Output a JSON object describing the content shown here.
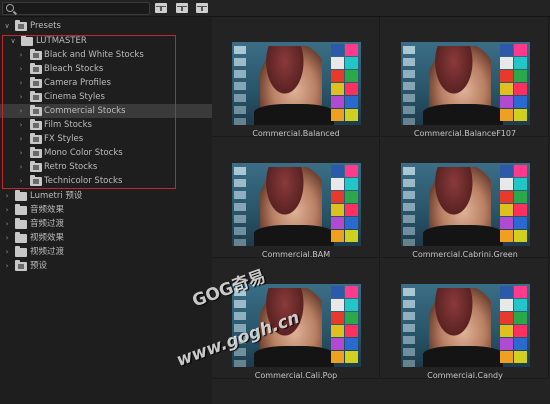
{
  "search": {
    "value": "",
    "placeholder": ""
  },
  "toolbar": {
    "buttons": [
      "new-bin-icon",
      "new-preset-icon",
      "new-item-icon"
    ]
  },
  "tree": [
    {
      "label": "Presets",
      "level": 0,
      "expanded": true,
      "icon": "preset-folder-icon"
    },
    {
      "label": "LUTMASTER",
      "level": 1,
      "expanded": true,
      "icon": "folder-icon"
    },
    {
      "label": "Black and White Stocks",
      "level": 2,
      "expanded": false,
      "icon": "preset-folder-icon"
    },
    {
      "label": "Bleach Stocks",
      "level": 2,
      "expanded": false,
      "icon": "preset-folder-icon"
    },
    {
      "label": "Camera Profiles",
      "level": 2,
      "expanded": false,
      "icon": "preset-folder-icon"
    },
    {
      "label": "Cinema Styles",
      "level": 2,
      "expanded": false,
      "icon": "preset-folder-icon"
    },
    {
      "label": "Commercial Stocks",
      "level": 2,
      "expanded": false,
      "icon": "preset-folder-icon",
      "selected": true
    },
    {
      "label": "Film Stocks",
      "level": 2,
      "expanded": false,
      "icon": "preset-folder-icon"
    },
    {
      "label": "FX Styles",
      "level": 2,
      "expanded": false,
      "icon": "preset-folder-icon"
    },
    {
      "label": "Mono Color Stocks",
      "level": 2,
      "expanded": false,
      "icon": "preset-folder-icon"
    },
    {
      "label": "Retro Stocks",
      "level": 2,
      "expanded": false,
      "icon": "preset-folder-icon"
    },
    {
      "label": "Technicolor Stocks",
      "level": 2,
      "expanded": false,
      "icon": "preset-folder-icon"
    },
    {
      "label": "Lumetri 预设",
      "level": 0,
      "expanded": false,
      "icon": "folder-icon"
    },
    {
      "label": "音频效果",
      "level": 0,
      "expanded": false,
      "icon": "folder-icon"
    },
    {
      "label": "音频过渡",
      "level": 0,
      "expanded": false,
      "icon": "folder-icon"
    },
    {
      "label": "视频效果",
      "level": 0,
      "expanded": false,
      "icon": "folder-icon"
    },
    {
      "label": "视频过渡",
      "level": 0,
      "expanded": false,
      "icon": "folder-icon"
    },
    {
      "label": "预设",
      "level": 0,
      "expanded": false,
      "icon": "preset-folder-icon"
    }
  ],
  "thumbnails": [
    {
      "name": "Commercial.Balanced"
    },
    {
      "name": "Commercial.BalanceF107"
    },
    {
      "name": "Commercial.BAM"
    },
    {
      "name": "Commercial.Cabrini.Green"
    },
    {
      "name": "Commercial.Cali.Pop"
    },
    {
      "name": "Commercial.Candy"
    }
  ],
  "watermark": {
    "line1": "GOG奇易",
    "line2": "www.gogh.cn"
  },
  "colors": {
    "background": "#1e1e1e",
    "selection": "#3a3a3a",
    "highlight_box": "#c0292b"
  }
}
